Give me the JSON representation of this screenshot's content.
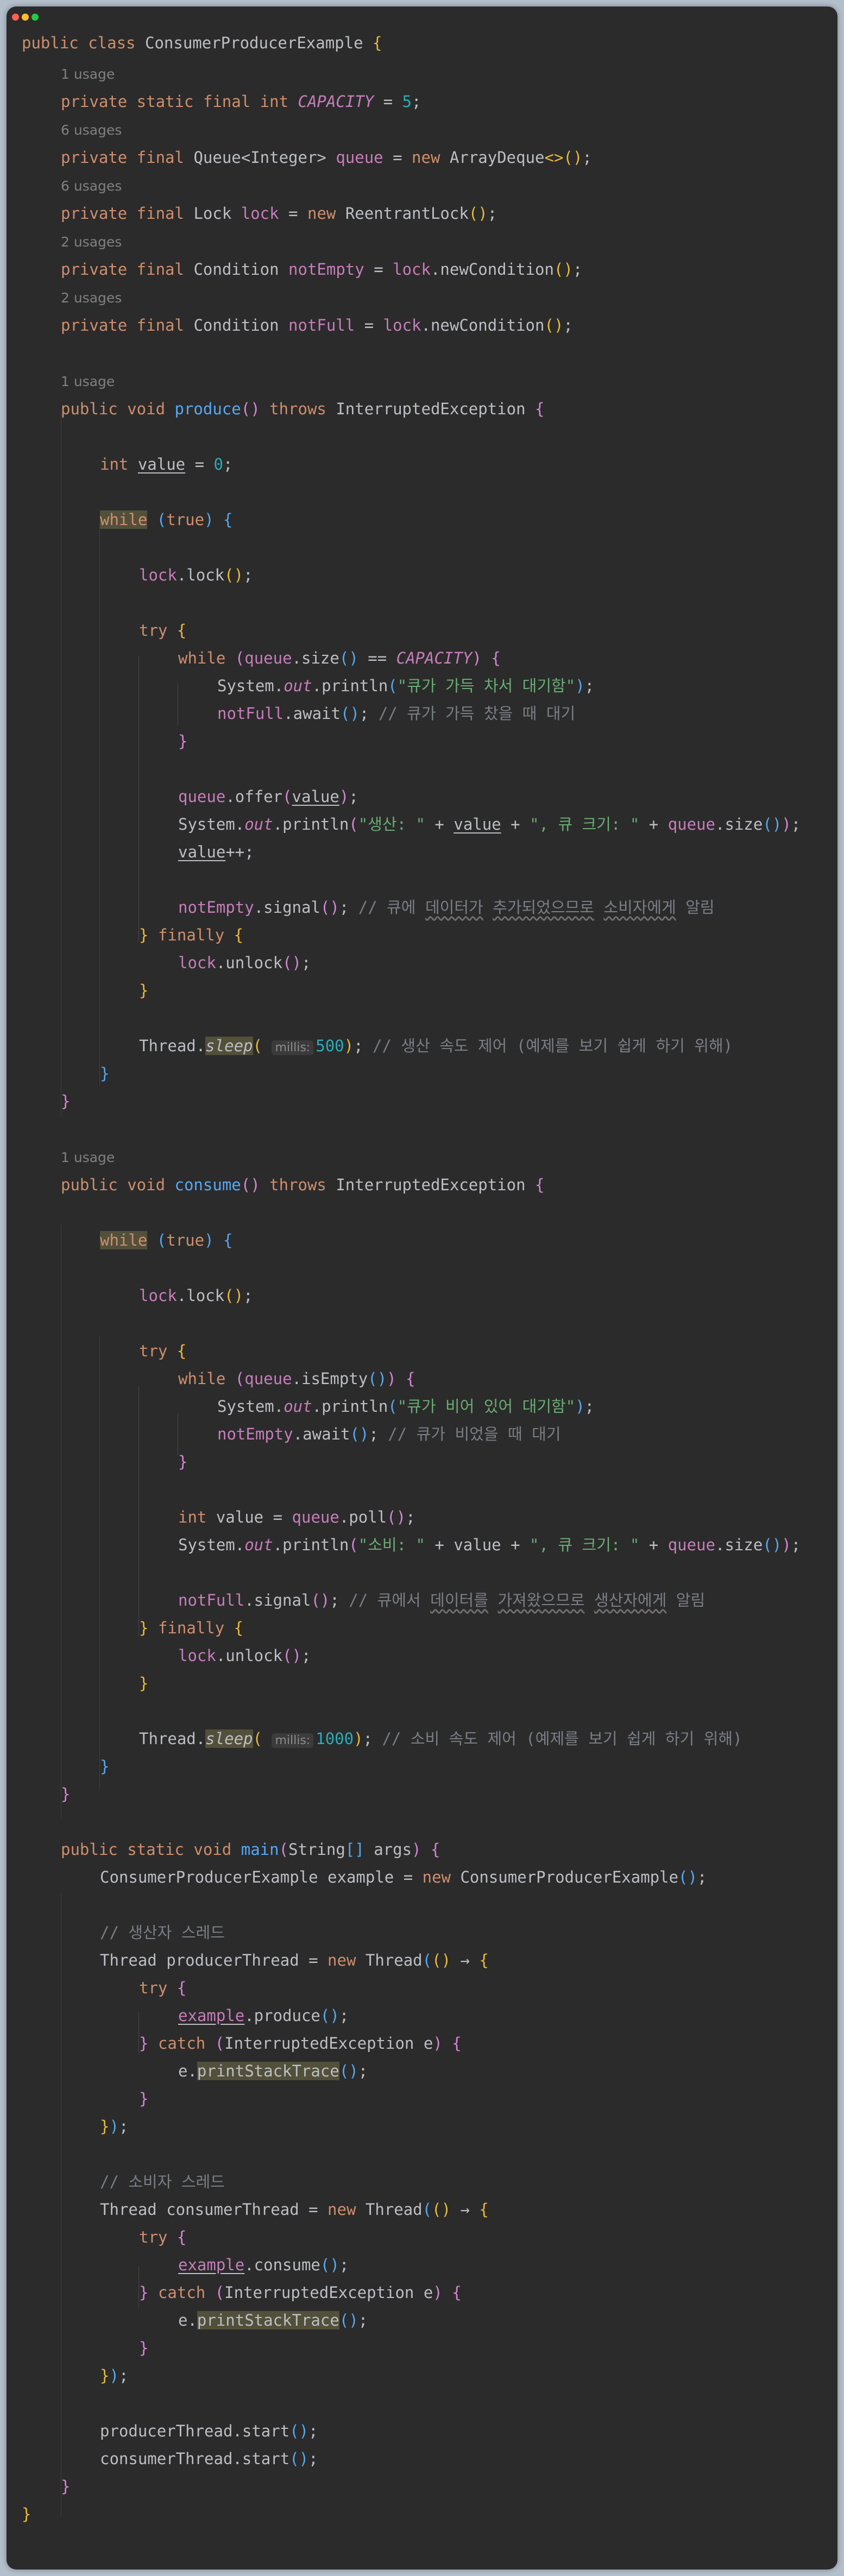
{
  "window": {
    "controls": [
      "close-dot",
      "minimize-dot",
      "maximize-dot"
    ],
    "colors": {
      "close": "#ff5f57",
      "minimize": "#febc2e",
      "maximize": "#28c840",
      "background": "#2b2b2b"
    }
  },
  "code": {
    "usage_1": "1 usage",
    "usage_6": "6 usages",
    "usage_2": "2 usages",
    "class_decl": "public class ConsumerProducerExample {",
    "capacity": "private static final int CAPACITY = 5;",
    "queue": "private final Queue<Integer> queue = new ArrayDeque<>();",
    "lock": "private final Lock lock = new ReentrantLock();",
    "notEmpty": "private final Condition notEmpty = lock.newCondition();",
    "notFull": "private final Condition notFull = lock.newCondition();",
    "produce_decl": "public void produce() throws InterruptedException {",
    "int_value": "int value = 0;",
    "while_true": "while (true) {",
    "lock_lock": "lock.lock();",
    "try_open": "try {",
    "while_full": "while (queue.size() == CAPACITY) {",
    "println_full": "System.out.println(\"큐가 가득 차서 대기함\");",
    "notfull_await": "notFull.await(); // 큐가 가득 찼을 때 대기",
    "close_brace": "}",
    "offer": "queue.offer(value);",
    "println_produce": "System.out.println(\"생산: \" + value + \", 큐 크기: \" + queue.size());",
    "value_inc": "value++;",
    "notempty_signal": "notEmpty.signal(); // 큐에 데이터가 추가되었으므로 소비자에게 알림",
    "finally_open": "} finally {",
    "unlock": "lock.unlock();",
    "sleep_produce": "Thread.sleep( millis: 500); // 생산 속도 제어 (예제를 보기 쉽게 하기 위해)",
    "consume_decl": "public void consume() throws InterruptedException {",
    "while_empty": "while (queue.isEmpty()) {",
    "println_empty": "System.out.println(\"큐가 비어 있어 대기함\");",
    "notempty_await": "notEmpty.await(); // 큐가 비었을 때 대기",
    "poll": "int value = queue.poll();",
    "println_consume": "System.out.println(\"소비: \" + value + \", 큐 크기: \" + queue.size());",
    "notfull_signal": "notFull.signal(); // 큐에서 데이터를 가져왔으므로 생산자에게 알림",
    "sleep_consume": "Thread.sleep( millis: 1000); // 소비 속도 제어 (예제를 보기 쉽게 하기 위해)",
    "main_decl": "public static void main(String[] args) {",
    "example_new": "ConsumerProducerExample example = new ConsumerProducerExample();",
    "comment_producer": "// 생산자 스레드",
    "producer_thread": "Thread producerThread = new Thread(() -> {",
    "call_produce": "example.produce();",
    "catch": "} catch (InterruptedException e) {",
    "print_stack": "e.printStackTrace();",
    "close_lambda": "});",
    "comment_consumer": "// 소비자 스레드",
    "consumer_thread": "Thread consumerThread = new Thread(() -> {",
    "call_consume": "example.consume();",
    "producer_start": "producerThread.start();",
    "consumer_start": "consumerThread.start();"
  }
}
